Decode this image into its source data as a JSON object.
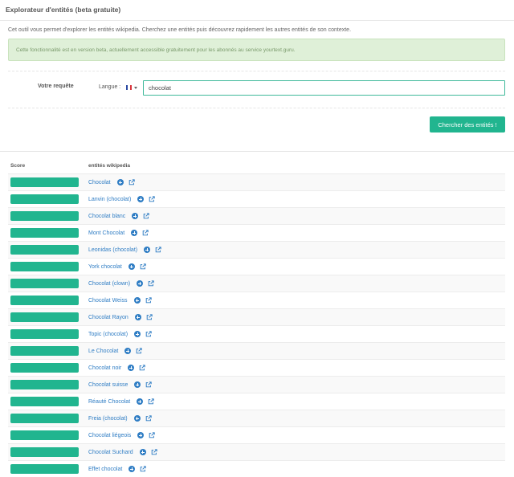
{
  "header": {
    "title": "Explorateur d'entités (beta gratuite)"
  },
  "intro": "Cet outil vous permet d'explorer les entités wikipedia. Cherchez une entités puis découvrez rapidement les autres entités de son contexte.",
  "beta_notice": "Cette fonctionnalité est en version beta, actuellement accessible gratuitement pour les abonnés au service yourtext.guru.",
  "form": {
    "query_label": "Votre requête",
    "language_label": "Langue :",
    "language_flag": "french-flag",
    "query_value": "chocolat",
    "submit_label": "Chercher des entités !"
  },
  "table": {
    "headers": {
      "score": "Score",
      "entities": "entités wikipedia"
    },
    "rows": [
      {
        "entity": "Chocolat",
        "score_fill": 1.0
      },
      {
        "entity": "Lanvin (chocolat)",
        "score_fill": 1.0
      },
      {
        "entity": "Chocolat blanc",
        "score_fill": 1.0
      },
      {
        "entity": "Mont Chocolat",
        "score_fill": 1.0
      },
      {
        "entity": "Leonidas (chocolat)",
        "score_fill": 1.0
      },
      {
        "entity": "York chocolat",
        "score_fill": 1.0
      },
      {
        "entity": "Chocolat (clown)",
        "score_fill": 1.0
      },
      {
        "entity": "Chocolat Weiss",
        "score_fill": 1.0
      },
      {
        "entity": "Chocolat Rayon",
        "score_fill": 1.0
      },
      {
        "entity": "Topic (chocolat)",
        "score_fill": 1.0
      },
      {
        "entity": "Le Chocolat",
        "score_fill": 1.0
      },
      {
        "entity": "Chocolat noir",
        "score_fill": 1.0
      },
      {
        "entity": "Chocolat suisse",
        "score_fill": 1.0
      },
      {
        "entity": "Réauté Chocolat",
        "score_fill": 1.0
      },
      {
        "entity": "Freia (chocolat)",
        "score_fill": 1.0
      },
      {
        "entity": "Chocolat liégeois",
        "score_fill": 1.0
      },
      {
        "entity": "Chocolat Suchard",
        "score_fill": 1.0
      },
      {
        "entity": "Effet chocolat",
        "score_fill": 1.0
      }
    ]
  },
  "icons": {
    "explore": "plus-circle-icon",
    "open": "external-link-icon"
  },
  "colors": {
    "accent": "#21b58f",
    "link": "#2f7dc4",
    "success_bg": "#dff0d8"
  }
}
